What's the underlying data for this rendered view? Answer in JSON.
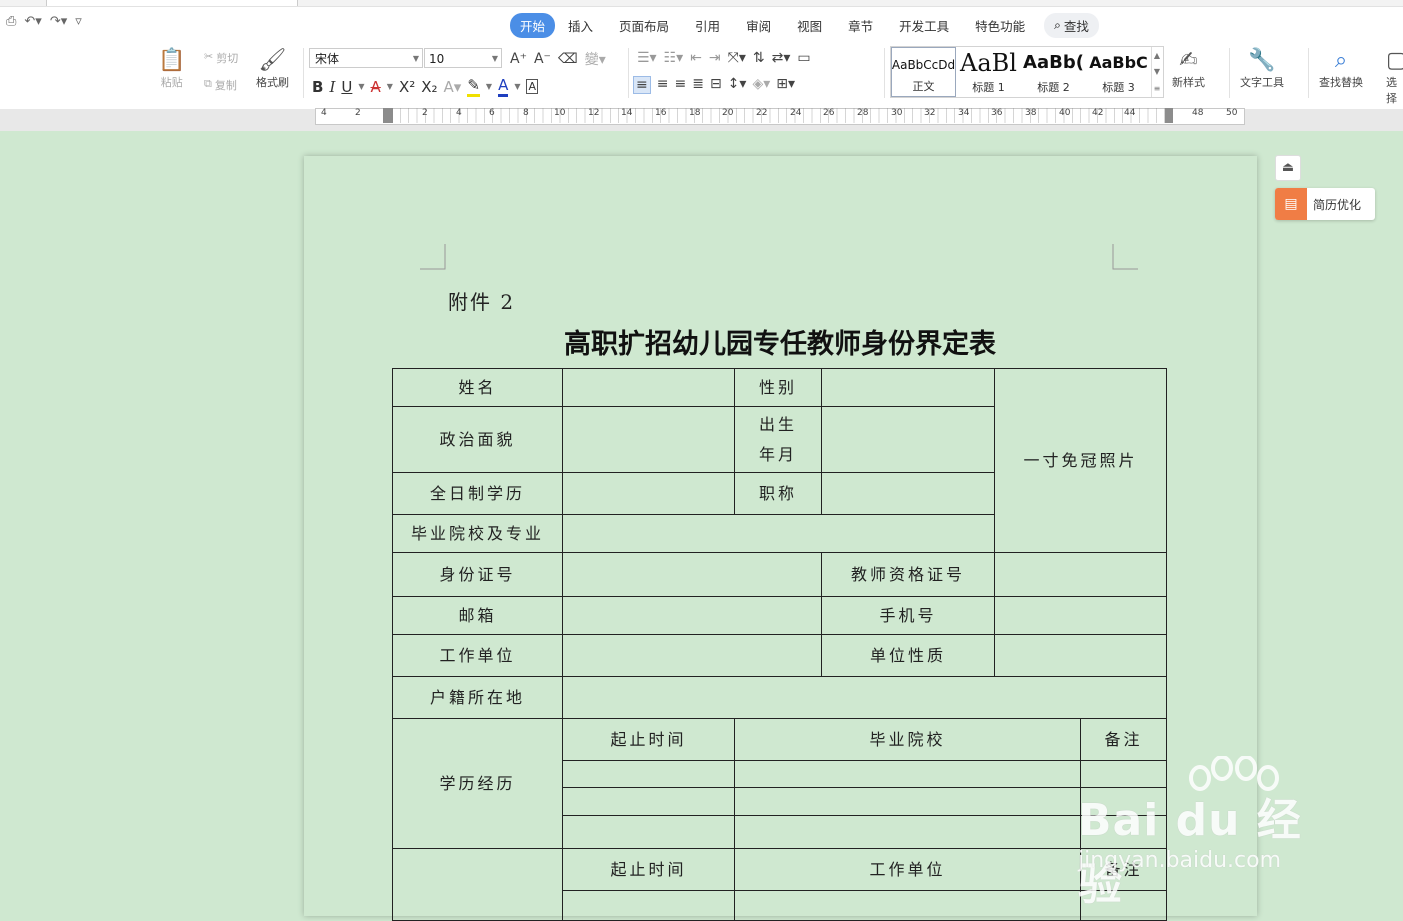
{
  "quick_access": {
    "icons": [
      "print-preview-icon",
      "undo-icon",
      "redo-icon",
      "customize-icon"
    ]
  },
  "menu": {
    "tabs": [
      "开始",
      "插入",
      "页面布局",
      "引用",
      "审阅",
      "视图",
      "章节",
      "开发工具",
      "特色功能"
    ],
    "active_tab": "开始",
    "search_label": "查找"
  },
  "ribbon": {
    "paste": "粘贴",
    "cut": "剪切",
    "copy": "复制",
    "format_painter": "格式刷",
    "font_name": "宋体",
    "font_size": "10",
    "styles": [
      {
        "preview": "AaBbCcDd",
        "label": "正文"
      },
      {
        "preview": "AaBl",
        "label": "标题 1"
      },
      {
        "preview": "AaBb(",
        "label": "标题 2"
      },
      {
        "preview": "AaBbC",
        "label": "标题 3"
      }
    ],
    "new_style": "新样式",
    "text_tools": "文字工具",
    "find_replace": "查找替换",
    "select": "选择"
  },
  "ruler": {
    "numbers": [
      "4",
      "2",
      "2",
      "4",
      "6",
      "8",
      "10",
      "12",
      "14",
      "16",
      "18",
      "20",
      "22",
      "24",
      "26",
      "28",
      "30",
      "32",
      "34",
      "36",
      "38",
      "40",
      "42",
      "44",
      "48",
      "50"
    ]
  },
  "side": {
    "resume_label": "简历优化"
  },
  "document": {
    "attachment": "附件 2",
    "title": "高职扩招幼儿园专任教师身份界定表",
    "table": {
      "name": "姓名",
      "gender": "性别",
      "photo": "一寸免冠照片",
      "political": "政治面貌",
      "birth1": "出生",
      "birth2": "年月",
      "education": "全日制学历",
      "title_rank": "职称",
      "school_major": "毕业院校及专业",
      "id_number": "身份证号",
      "teacher_cert": "教师资格证号",
      "email": "邮箱",
      "phone": "手机号",
      "work_unit": "工作单位",
      "unit_nature": "单位性质",
      "household": "户籍所在地",
      "edu_history": "学历经历",
      "period": "起止时间",
      "grad_school": "毕业院校",
      "remark": "备注",
      "period2": "起止时间",
      "work_unit2": "工作单位",
      "remark2": "备注"
    }
  },
  "watermark": {
    "brand": "Bai du 经验",
    "url": "jingyan.baidu.com"
  }
}
